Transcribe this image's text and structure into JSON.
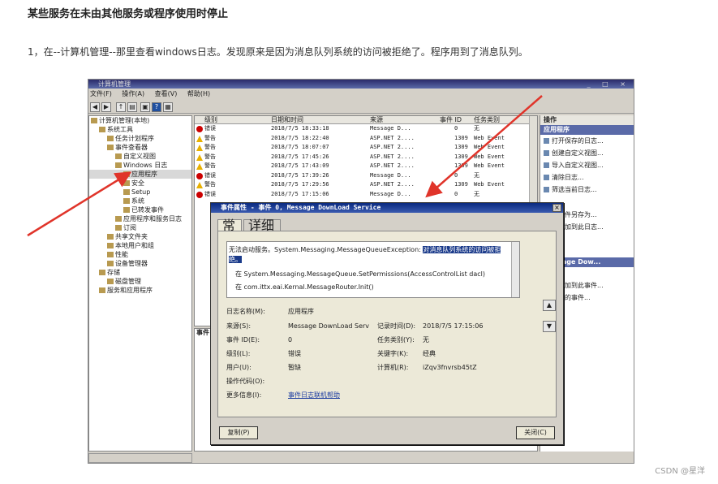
{
  "article": {
    "title": "某些服务在未由其他服务或程序使用时停止",
    "paragraph": "1，在--计算机管理--那里查看windows日志。发现原来是因为消息队列系统的访问被拒绝了。程序用到了消息队列。"
  },
  "window": {
    "title": "计算机管理",
    "menu": [
      "文件(F)",
      "操作(A)",
      "查看(V)",
      "帮助(H)"
    ]
  },
  "tree": [
    {
      "label": "计算机管理(本地)",
      "indent": 0
    },
    {
      "label": "系统工具",
      "indent": 1
    },
    {
      "label": "任务计划程序",
      "indent": 2
    },
    {
      "label": "事件查看器",
      "indent": 2
    },
    {
      "label": "自定义视图",
      "indent": 3
    },
    {
      "label": "Windows 日志",
      "indent": 3
    },
    {
      "label": "应用程序",
      "indent": 4
    },
    {
      "label": "安全",
      "indent": 4
    },
    {
      "label": "Setup",
      "indent": 4
    },
    {
      "label": "系统",
      "indent": 4
    },
    {
      "label": "已转发事件",
      "indent": 4
    },
    {
      "label": "应用程序和服务日志",
      "indent": 3
    },
    {
      "label": "订阅",
      "indent": 3
    },
    {
      "label": "共享文件夹",
      "indent": 2
    },
    {
      "label": "本地用户和组",
      "indent": 2
    },
    {
      "label": "性能",
      "indent": 2
    },
    {
      "label": "设备管理器",
      "indent": 2
    },
    {
      "label": "存储",
      "indent": 1
    },
    {
      "label": "磁盘管理",
      "indent": 2
    },
    {
      "label": "服务和应用程序",
      "indent": 1
    }
  ],
  "events": {
    "columns": [
      "级别",
      "日期和时间",
      "来源",
      "事件 ID",
      "任务类别"
    ],
    "rows": [
      {
        "level": "错误",
        "type": "error",
        "time": "2018/7/5 18:33:18",
        "source": "Message D...",
        "id": "0",
        "cat": "无"
      },
      {
        "level": "警告",
        "type": "warn",
        "time": "2018/7/5 18:22:40",
        "source": "ASP.NET 2....",
        "id": "1309",
        "cat": "Web Event"
      },
      {
        "level": "警告",
        "type": "warn",
        "time": "2018/7/5 18:07:07",
        "source": "ASP.NET 2....",
        "id": "1309",
        "cat": "Web Event"
      },
      {
        "level": "警告",
        "type": "warn",
        "time": "2018/7/5 17:45:26",
        "source": "ASP.NET 2....",
        "id": "1309",
        "cat": "Web Event"
      },
      {
        "level": "警告",
        "type": "warn",
        "time": "2018/7/5 17:43:09",
        "source": "ASP.NET 2....",
        "id": "1309",
        "cat": "Web Event"
      },
      {
        "level": "错误",
        "type": "error",
        "time": "2018/7/5 17:39:26",
        "source": "Message D...",
        "id": "0",
        "cat": "无"
      },
      {
        "level": "警告",
        "type": "warn",
        "time": "2018/7/5 17:29:56",
        "source": "ASP.NET 2....",
        "id": "1309",
        "cat": "Web Event"
      },
      {
        "level": "错误",
        "type": "error",
        "time": "2018/7/5 17:15:06",
        "source": "Message D...",
        "id": "0",
        "cat": "无"
      }
    ]
  },
  "actions": {
    "header": "操作",
    "section1": "应用程序",
    "items1": [
      "打开保存的日志...",
      "创建自定义视图...",
      "导入自定义视图...",
      "清除日志...",
      "筛选当前日志..."
    ],
    "items_mid": [
      "有事件另存为...",
      "务附加到此日志..."
    ],
    "section2": "Message Dow...",
    "items2": [
      "属性",
      "务附加到此事件...",
      "选择的事件..."
    ]
  },
  "lower_pane": {
    "title": "事件"
  },
  "dialog": {
    "title": "事件属性 - 事件 0, Message DownLoad Service",
    "close": "×",
    "tabs": [
      "常规",
      "详细信息"
    ],
    "message_lines": [
      "无法启动服务。System.Messaging.MessageQueueException: ",
      "对消息队列系统的访问被拒",
      "绝。",
      "在 System.Messaging.MessageQueue.SetPermissions(AccessControlList dacl)",
      "在 com.ittx.eai.Kernal.MessageRouter.Init()"
    ],
    "fields": {
      "log_name_label": "日志名称(M):",
      "log_name": "应用程序",
      "source_label": "来源(S):",
      "source": "Message DownLoad Serv",
      "logged_label": "记录时间(D):",
      "logged": "2018/7/5 17:15:06",
      "event_id_label": "事件 ID(E):",
      "event_id": "0",
      "task_label": "任务类别(Y):",
      "task": "无",
      "level_label": "级别(L):",
      "level": "错误",
      "keywords_label": "关键字(K):",
      "keywords": "经典",
      "user_label": "用户(U):",
      "user": "暂缺",
      "computer_label": "计算机(R):",
      "computer": "iZqv3fnvrsb45tZ",
      "opcode_label": "操作代码(O):",
      "more_info_label": "更多信息(I):",
      "more_info_link": "事件日志联机帮助"
    },
    "copy_button": "复制(P)",
    "close_button": "关闭(C)"
  },
  "watermark": "CSDN @星洋",
  "colors": {
    "arrow": "#e0342a",
    "selection": "#1a3a8a"
  }
}
